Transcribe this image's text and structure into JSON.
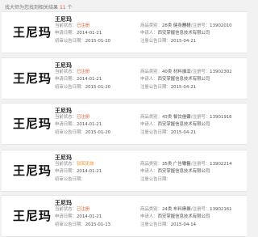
{
  "header": {
    "prefix": "找大师为您找到相关结果",
    "count": "11",
    "suffix": "个"
  },
  "labels": {
    "status": "当前状态：",
    "apply_date": "申请日期：",
    "prelim_date": "初审公告日期：",
    "category": "商品类别：",
    "applicant": "申请人：",
    "reg_no": "申请/注册号：",
    "reg_date": "注册公告日期："
  },
  "cards": [
    {
      "logo": "王尼玛",
      "title": "王尼玛",
      "status": "已注册",
      "status_type": "registered",
      "apply_date": "2014-01-21",
      "prelim_date": "2015-01-20",
      "category": "28类 健身器材",
      "applicant": "西安掌握信息技术有限公司",
      "reg_no": "13902010",
      "reg_date": "2015-04-21"
    },
    {
      "logo": "王尼玛",
      "title": "王尼玛",
      "status": "已注册",
      "status_type": "registered",
      "apply_date": "2014-01-21",
      "prelim_date": "2015-01-20",
      "category": "40类 材料加工",
      "applicant": "西安掌握信息技术有限公司",
      "reg_no": "13902302",
      "reg_date": "2015-04-21"
    },
    {
      "logo": "王尼玛",
      "title": "王尼玛",
      "status": "已注册",
      "status_type": "registered",
      "apply_date": "2014-01-21",
      "prelim_date": "2015-01-20",
      "category": "43类 餐饮住宿",
      "applicant": "西安掌握信息技术有限公司",
      "reg_no": "13901916",
      "reg_date": "2015-04-21"
    },
    {
      "logo": "王尼玛",
      "title": "王尼玛",
      "status": "驳回无效",
      "status_type": "rejected",
      "apply_date": "2014-01-21",
      "prelim_date": "",
      "category": "35类 广告销售",
      "applicant": "西安掌握信息技术有限公司",
      "reg_no": "13902214",
      "reg_date": ""
    },
    {
      "logo": "王尼玛",
      "title": "王尼玛",
      "status": "已注册",
      "status_type": "registered",
      "apply_date": "2014-01-21",
      "prelim_date": "2015-01-13",
      "category": "24类 布料床单",
      "applicant": "西安掌握信息技术有限公司",
      "reg_no": "13902161",
      "reg_date": "2015-04-14"
    }
  ]
}
